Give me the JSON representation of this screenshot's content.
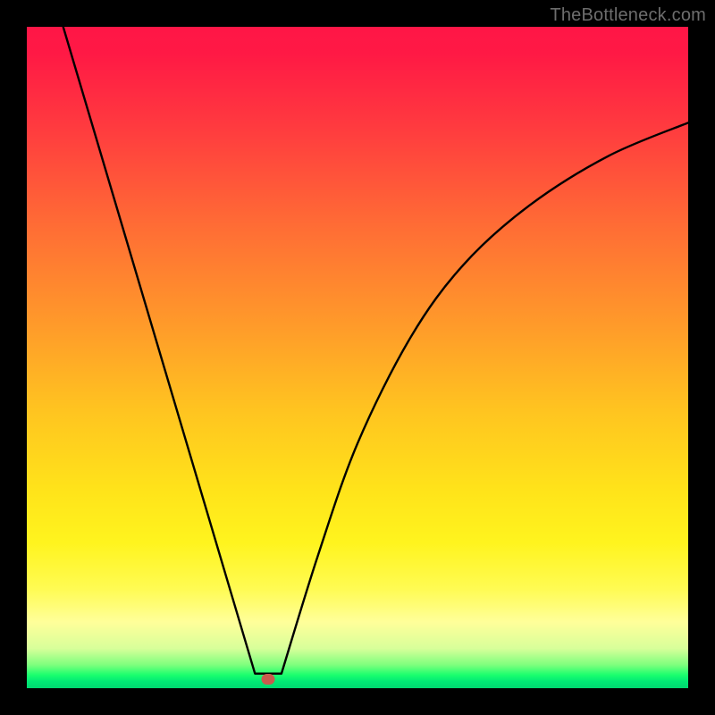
{
  "attribution": "TheBottleneck.com",
  "colors": {
    "page_bg": "#000000",
    "gradient_top": "#ff1646",
    "gradient_mid": "#ffe31a",
    "gradient_bottom": "#00d770",
    "curve": "#000000",
    "marker": "#c85a4d",
    "attribution_text": "#6d6d6d"
  },
  "chart_data": {
    "type": "line",
    "title": "",
    "xlabel": "",
    "ylabel": "",
    "x_range": [
      0,
      100
    ],
    "y_range": [
      0,
      100
    ],
    "left_branch": {
      "description": "nearly straight descending segment from top-left to valley",
      "points": [
        {
          "x": 5.5,
          "y": 100
        },
        {
          "x": 34.5,
          "y": 2.2
        }
      ]
    },
    "right_branch": {
      "description": "concave-up rising curve from valley toward upper-right, decelerating",
      "points": [
        {
          "x": 38.5,
          "y": 2.2
        },
        {
          "x": 44,
          "y": 20
        },
        {
          "x": 50,
          "y": 37
        },
        {
          "x": 58,
          "y": 53
        },
        {
          "x": 66,
          "y": 64
        },
        {
          "x": 76,
          "y": 73
        },
        {
          "x": 88,
          "y": 80.5
        },
        {
          "x": 100,
          "y": 85.5
        }
      ]
    },
    "valley_flat": {
      "description": "short flat segment at the bottom of the V",
      "y": 2.2,
      "x_start": 34.5,
      "x_end": 38.5
    },
    "marker": {
      "x": 36.5,
      "y": 1.4,
      "shape": "rounded-rect",
      "color": "#c85a4d"
    },
    "background": {
      "type": "vertical-gradient",
      "stops": [
        {
          "pos": 0,
          "color": "#ff1646"
        },
        {
          "pos": 30,
          "color": "#ff6c35"
        },
        {
          "pos": 58,
          "color": "#ffc420"
        },
        {
          "pos": 85,
          "color": "#fffb53"
        },
        {
          "pos": 97,
          "color": "#1bff6e"
        },
        {
          "pos": 100,
          "color": "#00d770"
        }
      ]
    }
  }
}
